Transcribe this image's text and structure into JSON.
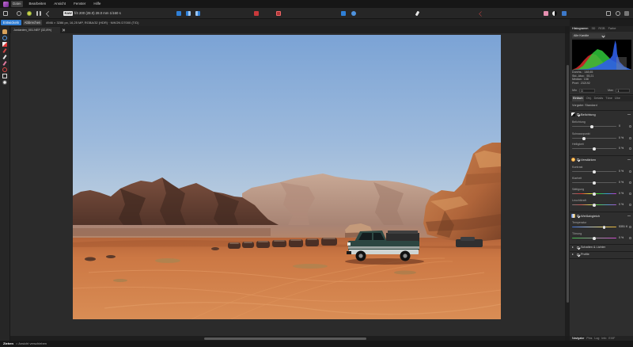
{
  "colors": {
    "accent": "#2e7bd1",
    "canvas": "#2b2b2b",
    "panel": "#2e2e2e"
  },
  "menu": [
    "Datei",
    "Bearbeiten",
    "Ansicht",
    "Fenster",
    "Hilfe"
  ],
  "toolbar": {
    "raw_badge": "RAW",
    "camera_info": "f/4 200 (28.0) 28.0 mm 1/160 s"
  },
  "persona_bar": {
    "develop_label": "Entwickeln",
    "cancel_label": "Abbrechen",
    "document_info": "4946 × 3286 px, 16,25 MP, RGBA/32 (HDR) · NIKON D7000 (T/D)"
  },
  "document": {
    "tab_title": "Jordanien_001.NEF (32,8%)"
  },
  "status_bar": {
    "action": "Ziehen",
    "hint": "= Ansicht verschieben"
  },
  "histogram_panel": {
    "tabs": [
      "Histogramm",
      "3D",
      "RGB",
      "Farbe"
    ],
    "channel": "Alle Kanäle",
    "stats": [
      {
        "label": "Durchs.:",
        "value": "148,65"
      },
      {
        "label": "Std.-Abw.:",
        "value": "55,21"
      },
      {
        "label": "Median:",
        "value": "158"
      },
      {
        "label": "Pixel:",
        "value": "232192"
      }
    ],
    "min_label": "Min",
    "min_value": "0",
    "max_label": "Max",
    "max_value": "1"
  },
  "develop_panel": {
    "tabs": [
      "Einfach",
      "Obj.",
      "Details",
      "Töne",
      "Übe"
    ],
    "preset_label": "Vorgabe:",
    "preset_value": "Standard",
    "exposure": {
      "title": "Belichtung",
      "sliders": [
        {
          "label": "Belichtung",
          "value": "0",
          "level": 0.45
        },
        {
          "label": "Schwarzpunkt",
          "value": "0 %",
          "level": 0.27
        },
        {
          "label": "Helligkeit",
          "value": "0 %",
          "level": 0.5
        }
      ]
    },
    "enhance": {
      "title": "Verstärken",
      "sliders": [
        {
          "label": "Kontrast",
          "value": "0 %",
          "level": 0.5
        },
        {
          "label": "Klarheit",
          "value": "0 %",
          "level": 0.5
        },
        {
          "label": "Sättigung",
          "value": "0 %",
          "level": 0.5
        },
        {
          "label": "Leuchtkraft",
          "value": "0 %",
          "level": 0.5
        }
      ]
    },
    "white_balance": {
      "title": "Weißabgleich",
      "sliders": [
        {
          "label": "Temperatur",
          "value": "5351 K",
          "level": 0.72
        },
        {
          "label": "Tönung",
          "value": "0 %",
          "level": 0.5
        }
      ]
    },
    "collapsed": [
      "Schatten & Lichter",
      "Profile"
    ]
  },
  "bottom_tabs": [
    "Navigator",
    "Pins",
    "Log",
    "Info",
    "EXIF"
  ]
}
